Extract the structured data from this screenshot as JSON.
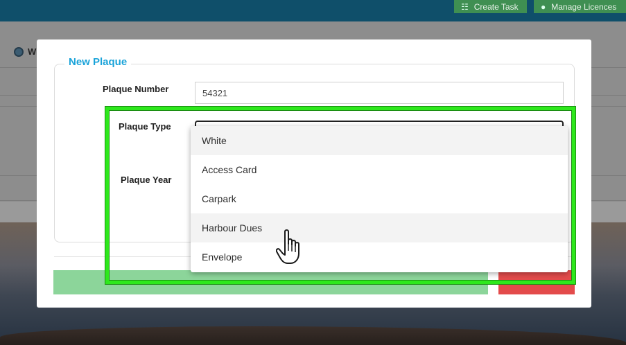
{
  "topbar": {
    "create_task_label": "Create Task",
    "manage_licences_label": "Manage Licences"
  },
  "background": {
    "section_title": "W"
  },
  "modal": {
    "legend": "New Plaque",
    "labels": {
      "plaque_number": "Plaque Number",
      "plaque_type": "Plaque Type",
      "plaque_year": "Plaque Year"
    },
    "plaque_number_value": "54321"
  },
  "dropdown": {
    "options": [
      "White",
      "Access Card",
      "Carpark",
      "Harbour Dues",
      "Envelope"
    ],
    "hovered": "Harbour Dues"
  },
  "colors": {
    "accent": "#1aa3d9",
    "highlight": "#2ee81c",
    "save": "#8cd59a",
    "cancel": "#e34b4b",
    "topbar": "#0f4f6a"
  }
}
